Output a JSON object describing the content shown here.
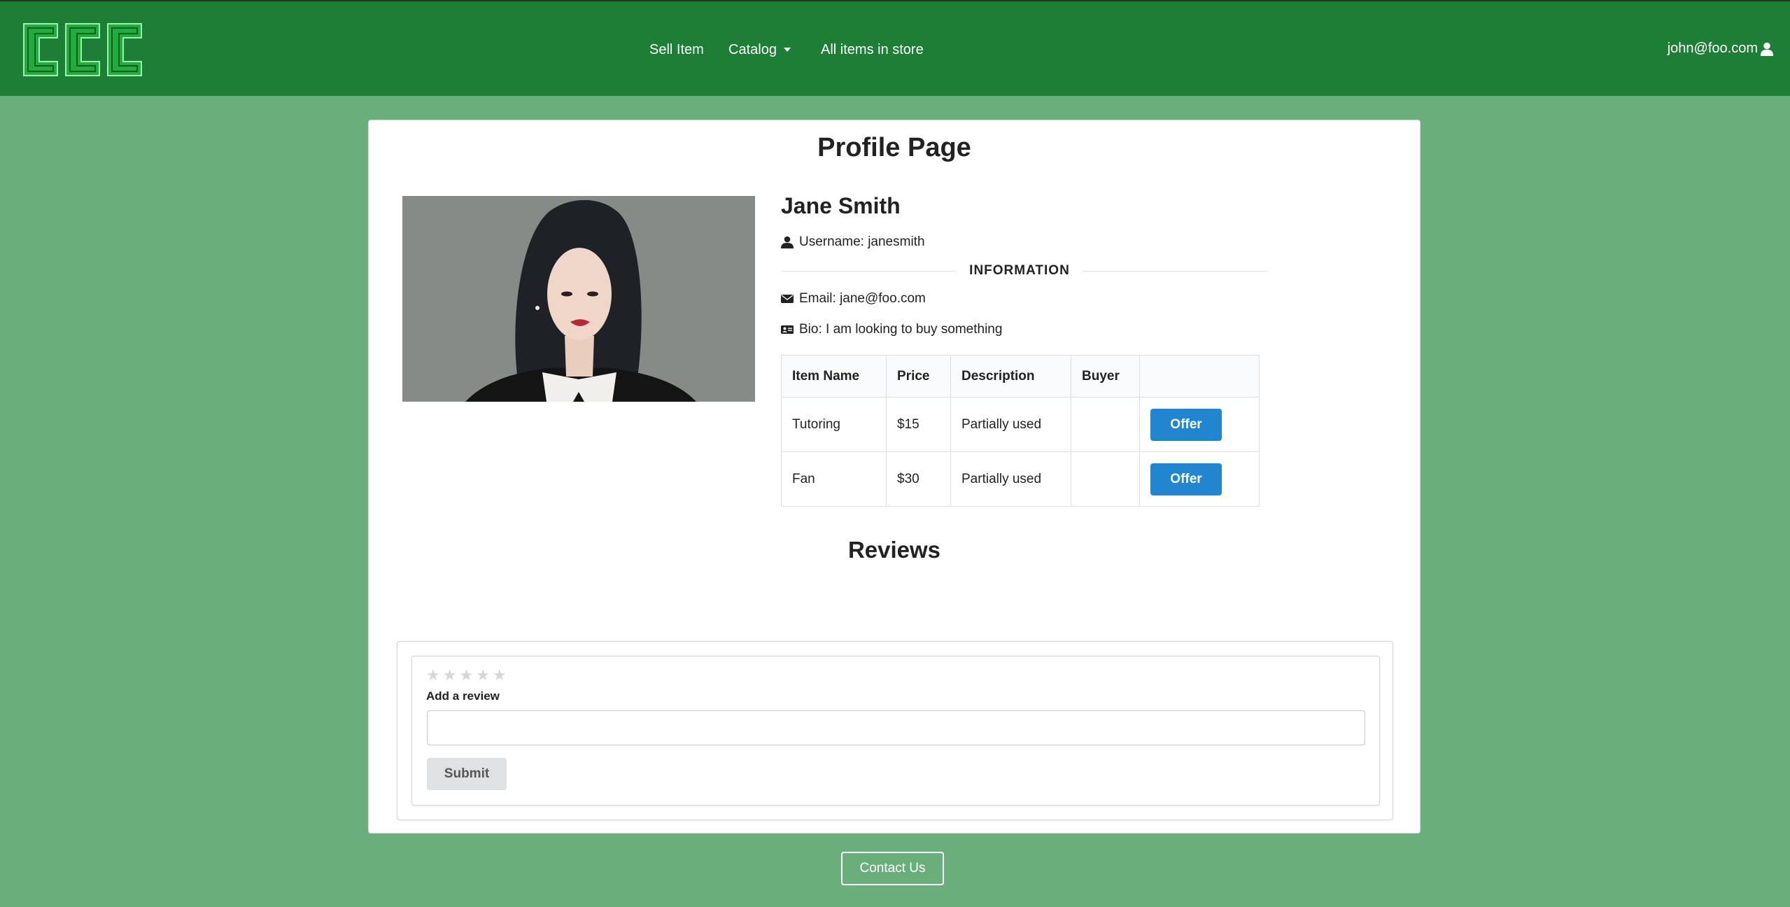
{
  "nav": {
    "logo_text": "CCC",
    "links": [
      "Sell Item",
      "Catalog",
      "All items in store"
    ],
    "user_email": "john@foo.com"
  },
  "profile": {
    "page_title": "Profile Page",
    "name": "Jane Smith",
    "username": "Username: janesmith",
    "section_label": "INFORMATION",
    "email": "Email: jane@foo.com",
    "bio": "Bio: I am looking to buy something"
  },
  "items_table": {
    "headers": [
      "Item Name",
      "Price",
      "Description",
      "Buyer",
      ""
    ],
    "rows": [
      {
        "name": "Tutoring",
        "price": "$15",
        "description": "Partially used",
        "buyer": "",
        "action": "Offer"
      },
      {
        "name": "Fan",
        "price": "$30",
        "description": "Partially used",
        "buyer": "",
        "action": "Offer"
      }
    ]
  },
  "reviews": {
    "title": "Reviews",
    "rating": 0,
    "max_rating": 5,
    "form_label": "Add a review",
    "input_value": "",
    "submit_label": "Submit"
  },
  "footer": {
    "contact_label": "Contact Us"
  },
  "colors": {
    "navbar": "#1d7e36",
    "page_background": "#6aaf7b",
    "offer_button": "#2185d0",
    "logo": "#22c44a"
  }
}
